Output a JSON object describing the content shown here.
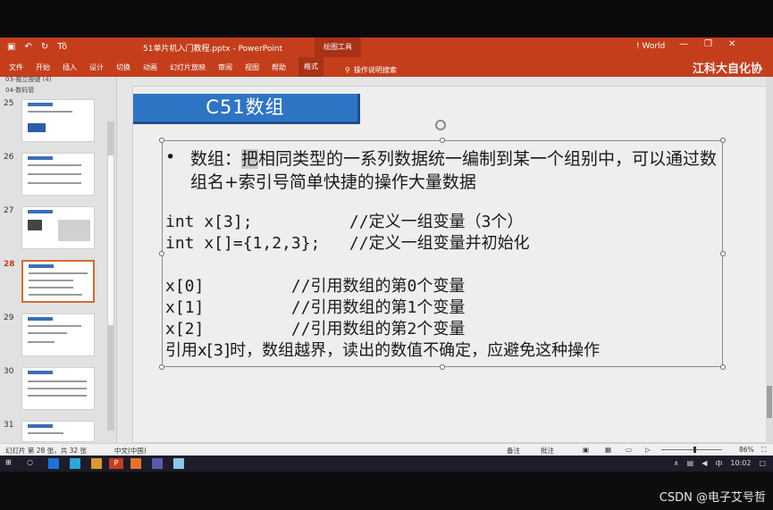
{
  "titlebar": {
    "qat_save": "▣",
    "qat_undo": "↶",
    "qat_redo": "↻",
    "qat_font": "Tõ",
    "doc_title": "51单片机入门教程.pptx - PowerPoint",
    "context_tool": "绘图工具",
    "account": "! World",
    "min": "—",
    "restore": "❐",
    "close": "✕"
  },
  "ribbon": {
    "tabs": [
      "文件",
      "开始",
      "插入",
      "设计",
      "切换",
      "动画",
      "幻灯片放映",
      "审阅",
      "视图",
      "帮助",
      "格式"
    ],
    "active_tab": "格式",
    "tellme": "操作说明搜索",
    "brand": "江科大自化协"
  },
  "thumbnails": {
    "section_prev": "03-独立按键 (4)",
    "section_current": "04-数码管",
    "slides": [
      {
        "num": "25"
      },
      {
        "num": "26"
      },
      {
        "num": "27"
      },
      {
        "num": "28",
        "current": true
      },
      {
        "num": "29"
      },
      {
        "num": "30"
      },
      {
        "num": "31"
      }
    ]
  },
  "slide": {
    "title": "C51数组",
    "bullet": "•",
    "para_pre": "数组：",
    "para_hl": "把",
    "para_post": "相同类型的一系列数据统一编制到某一个组别中，可以通过数组名+索引号简单快捷的操作大量数据",
    "code_lines": [
      "int x[3];          //定义一组变量（3个）",
      "int x[]={1,2,3};   //定义一组变量并初始化",
      "",
      "x[0]         //引用数组的第0个变量",
      "x[1]         //引用数组的第1个变量",
      "x[2]         //引用数组的第2个变量"
    ],
    "last_line": "引用x[3]时，数组越界，读出的数值不确定，应避免这种操作"
  },
  "status": {
    "slide_info": "幻灯片 第 28 张，共 32 张",
    "language": "中文(中国)",
    "notes": "备注",
    "comments": "批注",
    "zoom": "86%"
  },
  "taskbar": {
    "time": "10:02",
    "ime": "中",
    "app_label": "P"
  },
  "watermark": "CSDN @电子艾号哲",
  "colors": {
    "accent": "#c43e1c",
    "title_box": "#2e74c4"
  }
}
